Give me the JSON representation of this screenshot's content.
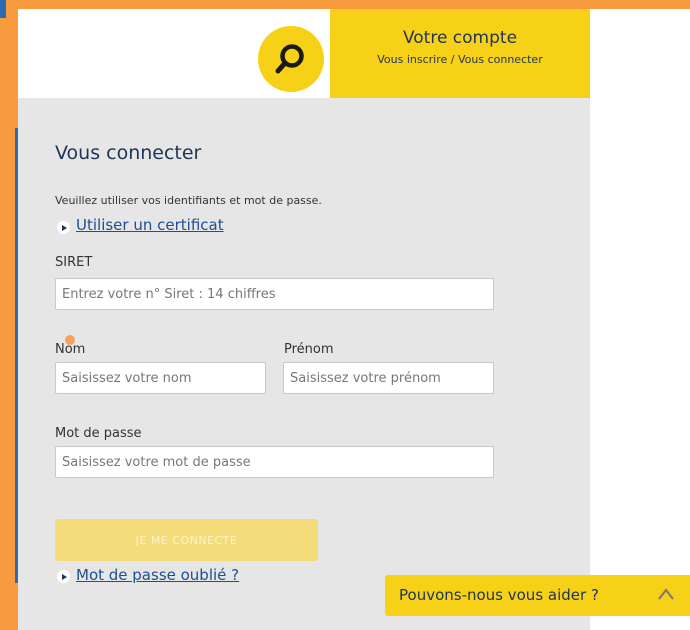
{
  "header": {
    "account_title": "Votre compte",
    "account_subtitle": "Vous inscrire / Vous connecter",
    "search_icon": "search-icon"
  },
  "login": {
    "heading": "Vous connecter",
    "intro": "Veuillez utiliser vos identifiants et mot de passe.",
    "certificate_link": "Utiliser un certificat",
    "siret_label": "SIRET",
    "siret_placeholder": "Entrez votre n° Siret : 14 chiffres",
    "nom_label": "Nom",
    "nom_placeholder": "Saisissez votre nom",
    "prenom_label": "Prénom",
    "prenom_placeholder": "Saisissez votre prénom",
    "password_label": "Mot de passe",
    "password_placeholder": "Saisissez votre mot de passe",
    "submit_label": "JE ME CONNECTE",
    "forgot_link": "Mot de passe oublié ?"
  },
  "help": {
    "label": "Pouvons-nous vous aider ?",
    "icon": "chevron-up-icon"
  },
  "colors": {
    "brand_yellow": "#f7d117",
    "accent_orange": "#f89a3e",
    "navy": "#1d3557",
    "link_blue": "#1d4f91",
    "panel_gray": "#e6e6e6"
  }
}
